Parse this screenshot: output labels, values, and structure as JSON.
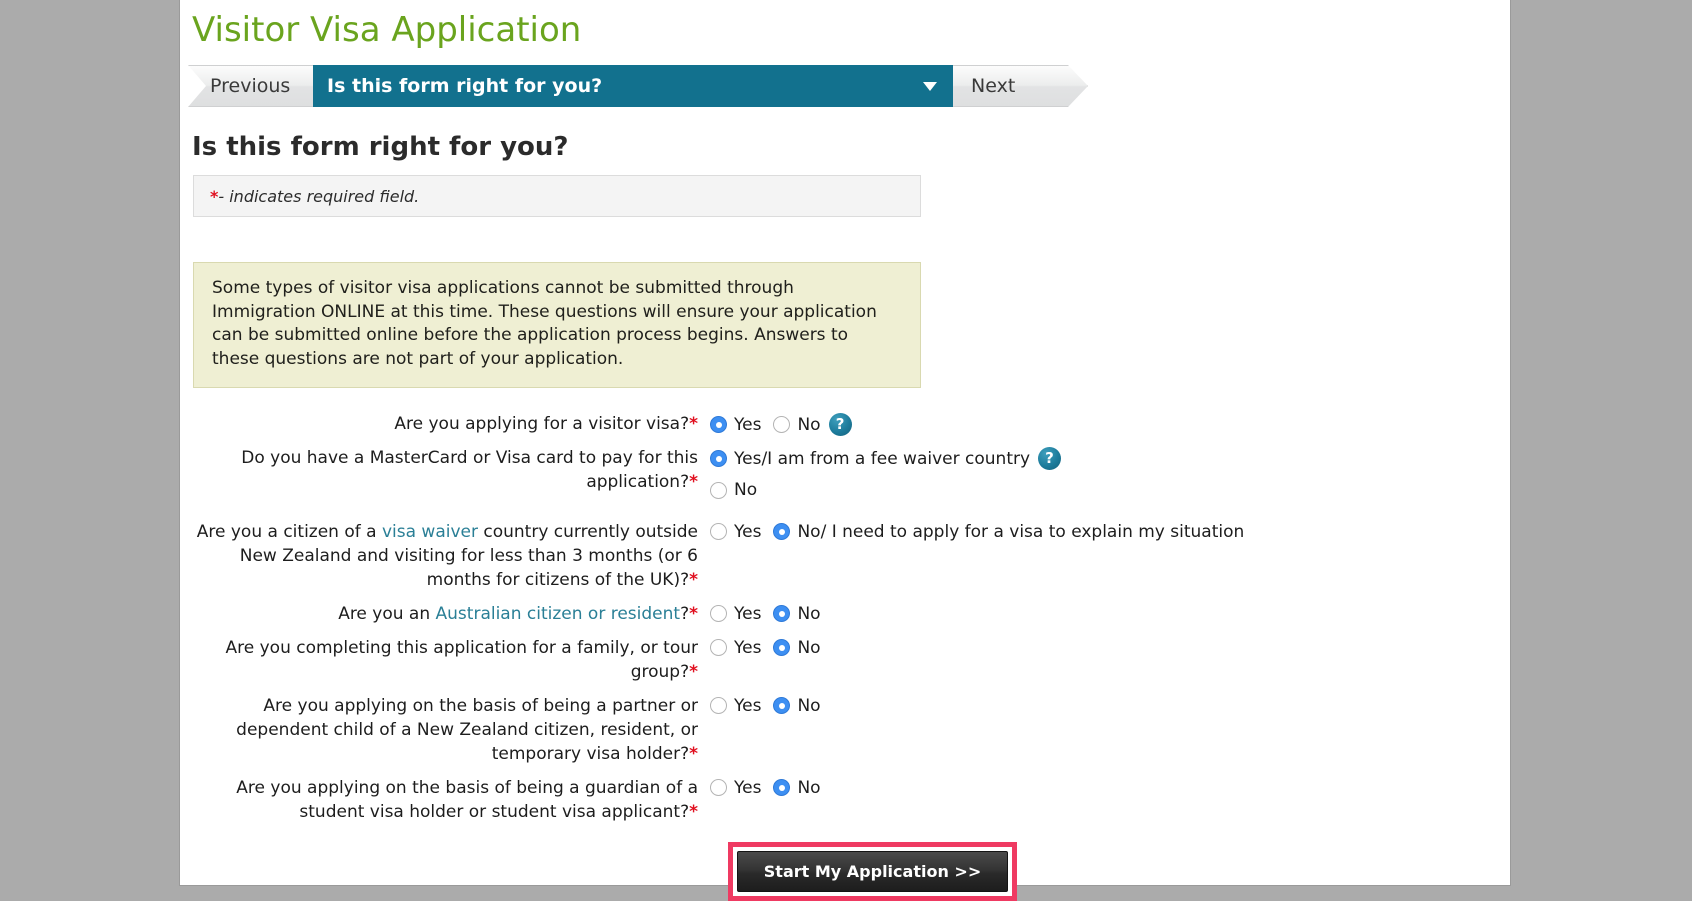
{
  "header": {
    "app_title": "Visitor Visa Application"
  },
  "nav": {
    "previous_label": "Previous",
    "current_step": "Is this form right for you?",
    "next_label": "Next",
    "caret_icon": "chevron-down-icon",
    "accent_color": "#12718e"
  },
  "section": {
    "heading": "Is this form right for you?",
    "required_note_asterisk": "*",
    "required_note": "- indicates required field.",
    "required_asterisk_color": "#e01020"
  },
  "info_box": {
    "text": "Some types of visitor visa applications cannot be submitted through Immigration ONLINE at this time. These questions will ensure your application can be submitted online before the application process begins. Answers to these questions are not part of your application.",
    "background_color": "#efefd3"
  },
  "questions": [
    {
      "id": "applying-for-visitor-visa",
      "label_parts": [
        {
          "text": "Are you applying for a visitor visa?",
          "link": false
        }
      ],
      "required": true,
      "layout": "inline",
      "help_icon": true,
      "options": [
        {
          "label": "Yes",
          "selected": true
        },
        {
          "label": "No",
          "selected": false
        }
      ]
    },
    {
      "id": "mastercard-or-visa-card",
      "label_parts": [
        {
          "text": "Do you have a MasterCard or Visa card to pay for this application?",
          "link": false
        }
      ],
      "required": true,
      "layout": "stacked",
      "help_icon": true,
      "options": [
        {
          "label": "Yes/I am from a fee waiver country",
          "selected": true
        },
        {
          "label": "No",
          "selected": false
        }
      ]
    },
    {
      "id": "visa-waiver-country-citizen",
      "label_parts": [
        {
          "text": "Are you a citizen of a ",
          "link": false
        },
        {
          "text": "visa waiver",
          "link": true
        },
        {
          "text": " country currently outside New Zealand and visiting for less than 3 months (or 6 months for citizens of the UK)?",
          "link": false
        }
      ],
      "required": true,
      "layout": "inline",
      "help_icon": false,
      "options": [
        {
          "label": "Yes",
          "selected": false
        },
        {
          "label": "No/ I need to apply for a visa to explain my situation",
          "selected": true
        }
      ]
    },
    {
      "id": "australian-citizen-or-resident",
      "label_parts": [
        {
          "text": "Are you an ",
          "link": false
        },
        {
          "text": "Australian citizen or resident",
          "link": true
        },
        {
          "text": "?",
          "link": false
        }
      ],
      "required": true,
      "layout": "inline",
      "help_icon": false,
      "options": [
        {
          "label": "Yes",
          "selected": false
        },
        {
          "label": "No",
          "selected": true
        }
      ]
    },
    {
      "id": "family-or-tour-group",
      "label_parts": [
        {
          "text": "Are you completing this application for a family, or tour group?",
          "link": false
        }
      ],
      "required": true,
      "layout": "inline",
      "help_icon": false,
      "options": [
        {
          "label": "Yes",
          "selected": false
        },
        {
          "label": "No",
          "selected": true
        }
      ]
    },
    {
      "id": "partner-or-dependent-child",
      "label_parts": [
        {
          "text": "Are you applying on the basis of being a partner or dependent child of a New Zealand citizen, resident, or temporary visa holder?",
          "link": false
        }
      ],
      "required": true,
      "layout": "inline",
      "help_icon": false,
      "options": [
        {
          "label": "Yes",
          "selected": false
        },
        {
          "label": "No",
          "selected": true
        }
      ]
    },
    {
      "id": "guardian-of-student",
      "label_parts": [
        {
          "text": "Are you applying on the basis of being a guardian of a student visa holder or student visa applicant?",
          "link": false
        }
      ],
      "required": true,
      "layout": "inline",
      "help_icon": false,
      "options": [
        {
          "label": "Yes",
          "selected": false
        },
        {
          "label": "No",
          "selected": true
        }
      ]
    }
  ],
  "submit": {
    "label": "Start My Application >>",
    "highlight_color": "#ef3a62"
  }
}
